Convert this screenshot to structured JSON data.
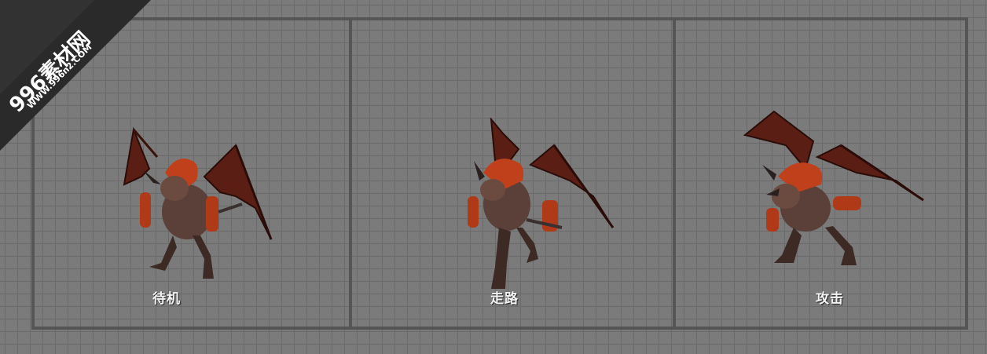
{
  "watermark": {
    "brand": "996素材网",
    "url": "WWW.996n2.COM"
  },
  "panels": [
    {
      "label": "待机"
    },
    {
      "label": "走路"
    },
    {
      "label": "攻击"
    }
  ],
  "colors": {
    "background": "#7b7b7b",
    "grid_line": "#6a6a6a",
    "frame": "#555555",
    "watermark_band": "#2a2a2a"
  }
}
